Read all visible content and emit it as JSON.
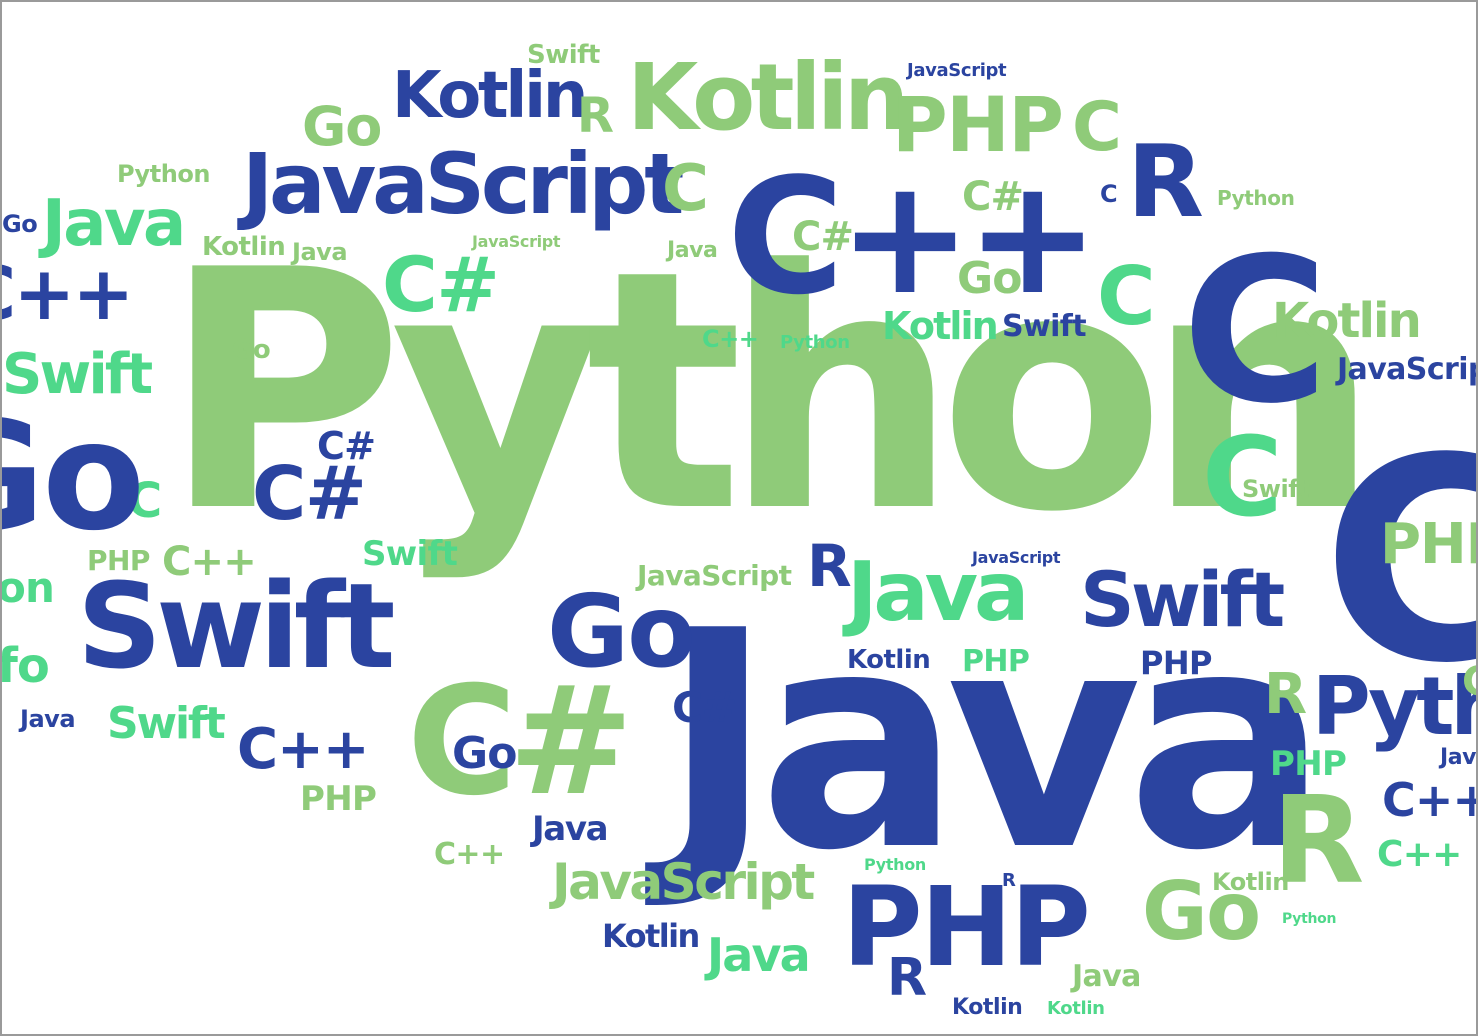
{
  "colors": {
    "dark_blue": "#2b44a0",
    "light_green": "#8fcb79",
    "bright_green": "#4fd88a",
    "background": "#ffffff"
  },
  "words": [
    {
      "text": "Python",
      "color": "light_green"
    },
    {
      "text": "Java",
      "color": "dark_blue"
    },
    {
      "text": "C",
      "color": "dark_blue"
    },
    {
      "text": "C",
      "color": "dark_blue"
    },
    {
      "text": "C++",
      "color": "dark_blue"
    },
    {
      "text": "JavaScript",
      "color": "dark_blue"
    },
    {
      "text": "Swift",
      "color": "dark_blue"
    },
    {
      "text": "Kotlin",
      "color": "light_green"
    },
    {
      "text": "Kotlin",
      "color": "dark_blue"
    },
    {
      "text": "PHP",
      "color": "light_green"
    },
    {
      "text": "R",
      "color": "dark_blue"
    },
    {
      "text": "C",
      "color": "light_green"
    },
    {
      "text": "Go",
      "color": "dark_blue"
    },
    {
      "text": "C#",
      "color": "light_green"
    },
    {
      "text": "PHP",
      "color": "dark_blue"
    },
    {
      "text": "R",
      "color": "light_green"
    },
    {
      "text": "Go",
      "color": "light_green"
    },
    {
      "text": "Java",
      "color": "bright_green"
    },
    {
      "text": "Swift",
      "color": "dark_blue"
    },
    {
      "text": "Java",
      "color": "bright_green"
    },
    {
      "text": "C#",
      "color": "bright_green"
    },
    {
      "text": "C",
      "color": "bright_green"
    },
    {
      "text": "C",
      "color": "bright_green"
    },
    {
      "text": "C#",
      "color": "dark_blue"
    },
    {
      "text": "Go",
      "color": "light_green"
    },
    {
      "text": "C",
      "color": "light_green"
    },
    {
      "text": "C",
      "color": "bright_green"
    },
    {
      "text": "Kotlin",
      "color": "light_green"
    },
    {
      "text": "R",
      "color": "dark_blue"
    },
    {
      "text": "JavaScript",
      "color": "light_green"
    },
    {
      "text": "Python",
      "color": "dark_blue"
    },
    {
      "text": "Go",
      "color": "dark_blue"
    },
    {
      "text": "Swift",
      "color": "bright_green"
    },
    {
      "text": "C++",
      "color": "dark_blue"
    },
    {
      "text": "Swift",
      "color": "bright_green"
    },
    {
      "text": "Kotlin",
      "color": "bright_green"
    },
    {
      "text": "R",
      "color": "light_green"
    },
    {
      "text": "R",
      "color": "dark_blue"
    },
    {
      "text": "C#",
      "color": "dark_blue"
    },
    {
      "text": "C#",
      "color": "dark_blue"
    },
    {
      "text": "Go",
      "color": "light_green"
    },
    {
      "text": "C#",
      "color": "light_green"
    },
    {
      "text": "C#",
      "color": "light_green"
    },
    {
      "text": "Java",
      "color": "dark_blue"
    },
    {
      "text": "Kotlin",
      "color": "dark_blue"
    },
    {
      "text": "Java",
      "color": "bright_green"
    },
    {
      "text": "C++",
      "color": "dark_blue"
    },
    {
      "text": "C++",
      "color": "bright_green"
    },
    {
      "text": "PHP",
      "color": "light_green"
    },
    {
      "text": "PHP",
      "color": "light_green"
    },
    {
      "text": "PHP",
      "color": "bright_green"
    },
    {
      "text": "PHP",
      "color": "bright_green"
    },
    {
      "text": "PHP",
      "color": "dark_blue"
    },
    {
      "text": "R",
      "color": "dark_blue"
    },
    {
      "text": "Swift",
      "color": "bright_green"
    },
    {
      "text": "Swift",
      "color": "dark_blue"
    },
    {
      "text": "Swift",
      "color": "light_green"
    },
    {
      "text": "Go",
      "color": "light_green"
    },
    {
      "text": "Go",
      "color": "dark_blue"
    },
    {
      "text": "C",
      "color": "dark_blue"
    },
    {
      "text": "Kotlin",
      "color": "light_green"
    },
    {
      "text": "Kotlin",
      "color": "dark_blue"
    },
    {
      "text": "Kotlin",
      "color": "dark_blue"
    },
    {
      "text": "Kotlin",
      "color": "light_green"
    },
    {
      "text": "Kotlin",
      "color": "bright_green"
    },
    {
      "text": "Java",
      "color": "dark_blue"
    },
    {
      "text": "Java",
      "color": "light_green"
    },
    {
      "text": "Java",
      "color": "light_green"
    },
    {
      "text": "Java",
      "color": "dark_blue"
    },
    {
      "text": "Java",
      "color": "light_green"
    },
    {
      "text": "C++",
      "color": "light_green"
    },
    {
      "text": "C++",
      "color": "bright_green"
    },
    {
      "text": "C++",
      "color": "dark_blue"
    },
    {
      "text": "C++",
      "color": "light_green"
    },
    {
      "text": "Python",
      "color": "light_green"
    },
    {
      "text": "Python",
      "color": "light_green"
    },
    {
      "text": "Python",
      "color": "bright_green"
    },
    {
      "text": "Python",
      "color": "bright_green"
    },
    {
      "text": "Python",
      "color": "bright_green"
    },
    {
      "text": "JavaScript",
      "color": "dark_blue"
    },
    {
      "text": "JavaScript",
      "color": "light_green"
    },
    {
      "text": "JavaScript",
      "color": "light_green"
    },
    {
      "text": "JavaScript",
      "color": "dark_blue"
    },
    {
      "text": "JavaScript",
      "color": "dark_blue"
    },
    {
      "text": "Swift",
      "color": "light_green"
    },
    {
      "text": "Go",
      "color": "dark_blue"
    },
    {
      "text": "R",
      "color": "dark_blue"
    },
    {
      "text": "C",
      "color": "light_green"
    },
    {
      "text": "on",
      "color": "bright_green"
    },
    {
      "text": "fo",
      "color": "bright_green"
    },
    {
      "text": "PHP",
      "color": "light_green"
    },
    {
      "text": "Swift",
      "color": "dark_blue"
    },
    {
      "text": "Swift",
      "color": "dark_blue"
    },
    {
      "text": "Java",
      "color": "light_green"
    },
    {
      "text": "C#",
      "color": "light_green"
    },
    {
      "text": "C",
      "color": "bright_green"
    }
  ]
}
